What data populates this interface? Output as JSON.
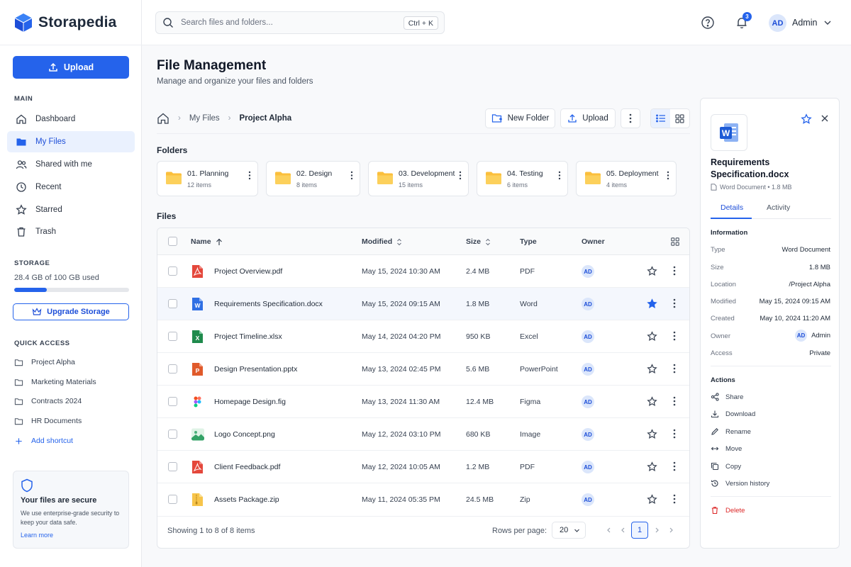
{
  "brand": {
    "name": "Storapedia",
    "accent": "#2563eb"
  },
  "sidebar": {
    "upload_label": "Upload",
    "main_title": "MAIN",
    "items": [
      {
        "label": "Dashboard",
        "icon": "home-icon"
      },
      {
        "label": "My Files",
        "icon": "folder-icon",
        "active": true
      },
      {
        "label": "Shared with me",
        "icon": "users-icon"
      },
      {
        "label": "Recent",
        "icon": "clock-icon"
      },
      {
        "label": "Starred",
        "icon": "star-icon"
      },
      {
        "label": "Trash",
        "icon": "trash-icon"
      }
    ],
    "storage": {
      "title": "STORAGE",
      "text": "28.4 GB of 100 GB used",
      "used_fraction": 0.284,
      "upgrade_label": "Upgrade Storage"
    },
    "quick_access": {
      "title": "QUICK ACCESS",
      "items": [
        "Project Alpha",
        "Marketing Materials",
        "Contracts 2024",
        "HR Documents"
      ],
      "add_label": "Add shortcut"
    },
    "secure": {
      "title": "Your files are secure",
      "desc": "We use enterprise-grade security to keep your data safe.",
      "link": "Learn more"
    }
  },
  "header": {
    "search_placeholder": "Search files and folders...",
    "shortcut": "Ctrl + K",
    "notification_count": "3",
    "user_initials": "AD",
    "user_name": "Admin"
  },
  "page": {
    "title": "File Management",
    "subtitle": "Manage and organize your files and folders"
  },
  "breadcrumb": {
    "items": [
      "My Files",
      "Project Alpha"
    ]
  },
  "toolbar": {
    "new_folder_label": "New Folder",
    "upload_label": "Upload"
  },
  "folders": {
    "label": "Folders",
    "items": [
      {
        "name": "01. Planning",
        "count": "12 items"
      },
      {
        "name": "02. Design",
        "count": "8 items"
      },
      {
        "name": "03. Development",
        "count": "15 items"
      },
      {
        "name": "04. Testing",
        "count": "6 items"
      },
      {
        "name": "05. Deployment",
        "count": "4 items"
      }
    ]
  },
  "files": {
    "label": "Files",
    "columns": {
      "name": "Name",
      "modified": "Modified",
      "size": "Size",
      "type": "Type",
      "owner": "Owner"
    },
    "rows": [
      {
        "name": "Project Overview.pdf",
        "modified": "May 15, 2024 10:30 AM",
        "size": "2.4 MB",
        "type": "PDF",
        "owner": "AD",
        "icon": "pdf",
        "starred": false
      },
      {
        "name": "Requirements Specification.docx",
        "modified": "May 15, 2024 09:15 AM",
        "size": "1.8 MB",
        "type": "Word",
        "owner": "AD",
        "icon": "word",
        "starred": true,
        "selected": true
      },
      {
        "name": "Project Timeline.xlsx",
        "modified": "May 14, 2024 04:20 PM",
        "size": "950 KB",
        "type": "Excel",
        "owner": "AD",
        "icon": "excel",
        "starred": false
      },
      {
        "name": "Design Presentation.pptx",
        "modified": "May 13, 2024 02:45 PM",
        "size": "5.6 MB",
        "type": "PowerPoint",
        "owner": "AD",
        "icon": "ppt",
        "starred": false
      },
      {
        "name": "Homepage Design.fig",
        "modified": "May 13, 2024 11:30 AM",
        "size": "12.4 MB",
        "type": "Figma",
        "owner": "AD",
        "icon": "figma",
        "starred": false
      },
      {
        "name": "Logo Concept.png",
        "modified": "May 12, 2024 03:10 PM",
        "size": "680 KB",
        "type": "Image",
        "owner": "AD",
        "icon": "image",
        "starred": false
      },
      {
        "name": "Client Feedback.pdf",
        "modified": "May 12, 2024 10:05 AM",
        "size": "1.2 MB",
        "type": "PDF",
        "owner": "AD",
        "icon": "pdf",
        "starred": false
      },
      {
        "name": "Assets Package.zip",
        "modified": "May 11, 2024 05:35 PM",
        "size": "24.5 MB",
        "type": "Zip",
        "owner": "AD",
        "icon": "zip",
        "starred": false
      }
    ],
    "footer": {
      "showing": "Showing 1 to 8 of 8 items",
      "rows_per_page_label": "Rows per page:",
      "rows_per_page": "20",
      "current_page": "1"
    }
  },
  "details": {
    "title": "Requirements Specification.docx",
    "meta": "Word Document • 1.8 MB",
    "tabs": [
      "Details",
      "Activity"
    ],
    "info_title": "Information",
    "info": [
      {
        "key": "Type",
        "value": "Word Document"
      },
      {
        "key": "Size",
        "value": "1.8 MB"
      },
      {
        "key": "Location",
        "value": "/Project Alpha"
      },
      {
        "key": "Modified",
        "value": "May 15, 2024 09:15 AM"
      },
      {
        "key": "Created",
        "value": "May 10, 2024 11:20 AM"
      },
      {
        "key": "Owner",
        "value": "Admin",
        "initials": "AD"
      },
      {
        "key": "Access",
        "value": "Private"
      }
    ],
    "actions_title": "Actions",
    "actions": [
      "Share",
      "Download",
      "Rename",
      "Move",
      "Copy",
      "Version history"
    ],
    "delete_label": "Delete"
  }
}
